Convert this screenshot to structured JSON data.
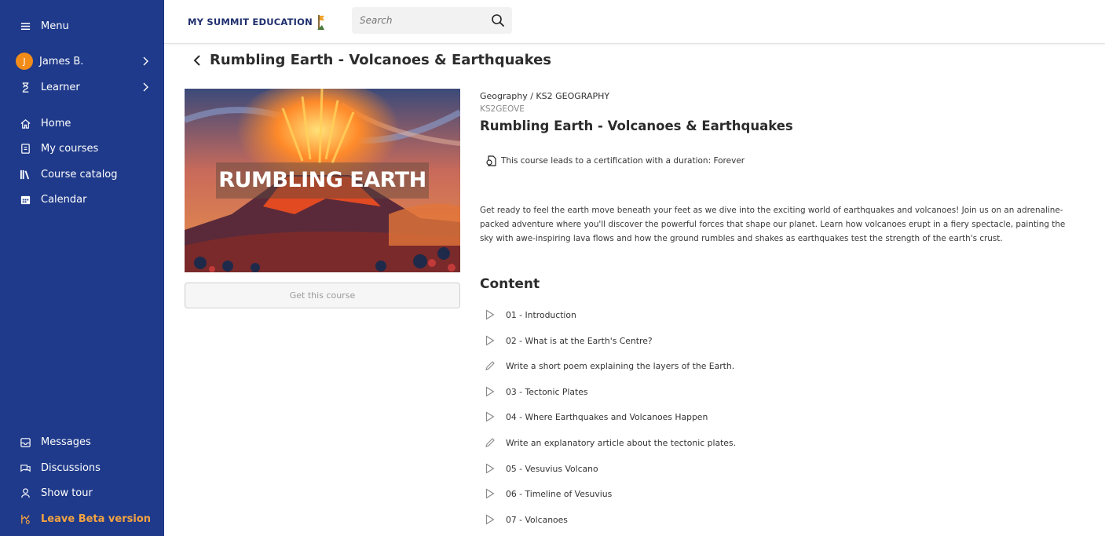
{
  "colors": {
    "sidebar_bg": "#1f3a8a",
    "accent_orange": "#f28c18",
    "beta_orange": "#f4a340"
  },
  "sidebar": {
    "menu_label": "Menu",
    "user": {
      "initial": "J",
      "name": "James B."
    },
    "role_label": "Learner",
    "nav": [
      {
        "label": "Home",
        "icon": "home-icon"
      },
      {
        "label": "My courses",
        "icon": "book-icon"
      },
      {
        "label": "Course catalog",
        "icon": "library-icon"
      },
      {
        "label": "Calendar",
        "icon": "calendar-icon"
      }
    ],
    "bottom": [
      {
        "label": "Messages",
        "icon": "messages-icon"
      },
      {
        "label": "Discussions",
        "icon": "discussions-icon"
      },
      {
        "label": "Show tour",
        "icon": "tour-icon"
      },
      {
        "label": "Leave Beta version",
        "icon": "beta-icon"
      }
    ]
  },
  "topbar": {
    "logo_text": "MY SUMMIT EDUCATION",
    "search_placeholder": "Search"
  },
  "page": {
    "title": "Rumbling Earth - Volcanoes & Earthquakes"
  },
  "course": {
    "image_text": "RUMBLING EARTH",
    "get_button": "Get this course",
    "path": "Geography / KS2 GEOGRAPHY",
    "code": "KS2GEOVE",
    "title": "Rumbling Earth - Volcanoes & Earthquakes",
    "certification": "This course leads to a certification with a duration: Forever",
    "description": "Get ready to feel the earth move beneath your feet as we dive into the exciting world of earthquakes and volcanoes! Join us on an adrenaline-packed adventure where you'll discover the powerful forces that shape our planet. Learn how volcanoes erupt in a fiery spectacle, painting the sky with awe-inspiring lava flows and how the ground rumbles and shakes as earthquakes test the strength of the earth's crust."
  },
  "content": {
    "heading": "Content",
    "items": [
      {
        "label": "01 - Introduction",
        "icon": "play-icon"
      },
      {
        "label": "02 - What is at the Earth's Centre?",
        "icon": "play-icon"
      },
      {
        "label": "Write a short poem explaining the layers of the Earth.",
        "icon": "pencil-icon"
      },
      {
        "label": "03 - Tectonic Plates",
        "icon": "play-icon"
      },
      {
        "label": "04 - Where Earthquakes and Volcanoes Happen",
        "icon": "play-icon"
      },
      {
        "label": "Write an explanatory article about the tectonic plates.",
        "icon": "pencil-icon"
      },
      {
        "label": "05 - Vesuvius Volcano",
        "icon": "play-icon"
      },
      {
        "label": "06 - Timeline of Vesuvius",
        "icon": "play-icon"
      },
      {
        "label": "07 - Volcanoes",
        "icon": "play-icon"
      }
    ]
  }
}
